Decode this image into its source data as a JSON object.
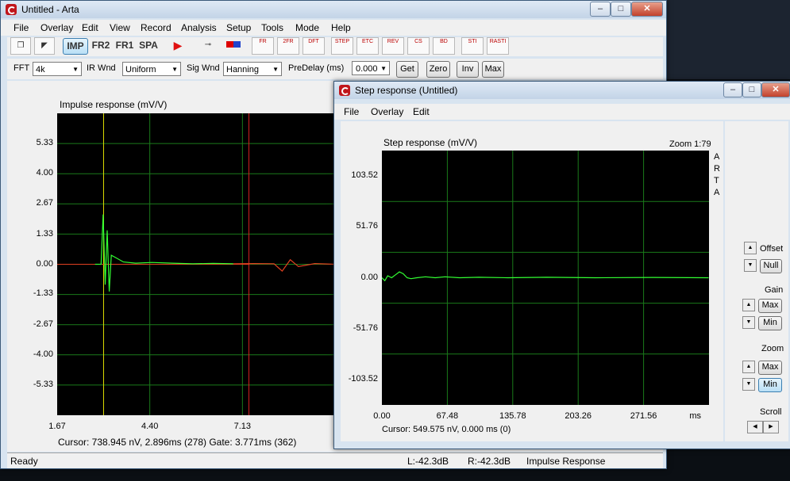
{
  "main": {
    "title": "Untitled - Arta",
    "menu": [
      "File",
      "Overlay",
      "Edit",
      "View",
      "Record",
      "Analysis",
      "Setup",
      "Tools",
      "Mode",
      "Help"
    ],
    "toolbar": {
      "imp": "IMP",
      "fr2": "FR2",
      "fr1": "FR1",
      "spa": "SPA",
      "small": [
        "FR",
        "2FR",
        "DFT",
        "STEP",
        "ETC",
        "REV",
        "CS",
        "BD",
        "STI",
        "RASTI"
      ]
    },
    "controls": {
      "fft_label": "FFT",
      "fft_value": "4k",
      "irwnd_label": "IR Wnd",
      "irwnd_value": "Uniform",
      "sigwnd_label": "Sig Wnd",
      "sigwnd_value": "Hanning",
      "predelay_label": "PreDelay (ms)",
      "predelay_value": "0.000",
      "get": "Get",
      "zero": "Zero",
      "inv": "Inv",
      "max": "Max"
    },
    "status": {
      "ready": "Ready",
      "left": "L:-42.3dB",
      "right": "R:-42.3dB",
      "mode": "Impulse Response"
    }
  },
  "step": {
    "title": "Step response (Untitled)",
    "menu": [
      "File",
      "Overlay",
      "Edit"
    ],
    "side": {
      "offset": "Offset",
      "null": "Null",
      "gain": "Gain",
      "gain_max": "Max",
      "gain_min": "Min",
      "zoom": "Zoom",
      "zoom_max": "Max",
      "zoom_min": "Min",
      "scroll": "Scroll"
    }
  },
  "chart_data": [
    {
      "type": "line",
      "title": "Impulse response (mV/V)",
      "yticks": [
        "5.33",
        "4.00",
        "2.67",
        "1.33",
        "0.00",
        "-1.33",
        "-2.67",
        "-4.00",
        "-5.33"
      ],
      "xticks": [
        "1.67",
        "4.40",
        "7.13"
      ],
      "ylim": [
        -6.67,
        6.67
      ],
      "xlim": [
        1.67,
        8.5
      ],
      "grid": true,
      "cursor_text": "Cursor: 738.945 nV, 2.896ms (278)  Gate: 3.771ms (362)",
      "colors": {
        "trace": "#32ff32",
        "gated": "#e04020",
        "cursor": "#e0e000",
        "gate": "#d02020",
        "grid": "#1a7a1a"
      },
      "series": [
        {
          "x": [
            2.6,
            2.75,
            2.8,
            2.85,
            2.9,
            2.95,
            3.0,
            3.1,
            3.3,
            3.6,
            4.0,
            4.5,
            5.0,
            5.5,
            6.0,
            6.5,
            7.0,
            7.2,
            7.4,
            7.6,
            8.0,
            8.5
          ],
          "values": [
            0,
            0,
            2.2,
            -0.9,
            1.5,
            -1.2,
            0.4,
            0.3,
            0.1,
            0.05,
            0.08,
            0.05,
            0.02,
            0.04,
            0.02,
            0.03,
            0.02,
            -0.3,
            0.2,
            -0.1,
            0.03,
            0
          ]
        }
      ]
    },
    {
      "type": "line",
      "title": "Step response (mV/V)",
      "annotation": "Zoom 1:79",
      "side_text": "ARTA",
      "yticks": [
        "103.52",
        "51.76",
        "0.00",
        "-51.76",
        "-103.52"
      ],
      "xticks": [
        "0.00",
        "67.48",
        "135.78",
        "203.26",
        "271.56"
      ],
      "xunit": "ms",
      "ylim": [
        -129.4,
        129.4
      ],
      "xlim": [
        0,
        337.4
      ],
      "grid": true,
      "cursor_text": "Cursor: 549.575 nV,   0.000 ms  (0)",
      "colors": {
        "trace": "#32ff32",
        "grid": "#1a7a1a"
      },
      "series": [
        {
          "x": [
            0,
            3,
            6,
            10,
            14,
            18,
            22,
            26,
            30,
            36,
            45,
            55,
            65,
            80,
            100,
            130,
            170,
            220,
            280,
            337
          ],
          "values": [
            0,
            -3,
            2,
            0,
            3,
            6,
            4,
            0,
            -1,
            0,
            1,
            0,
            1,
            0,
            0.5,
            0,
            0.5,
            0,
            0.3,
            0
          ]
        }
      ]
    }
  ]
}
